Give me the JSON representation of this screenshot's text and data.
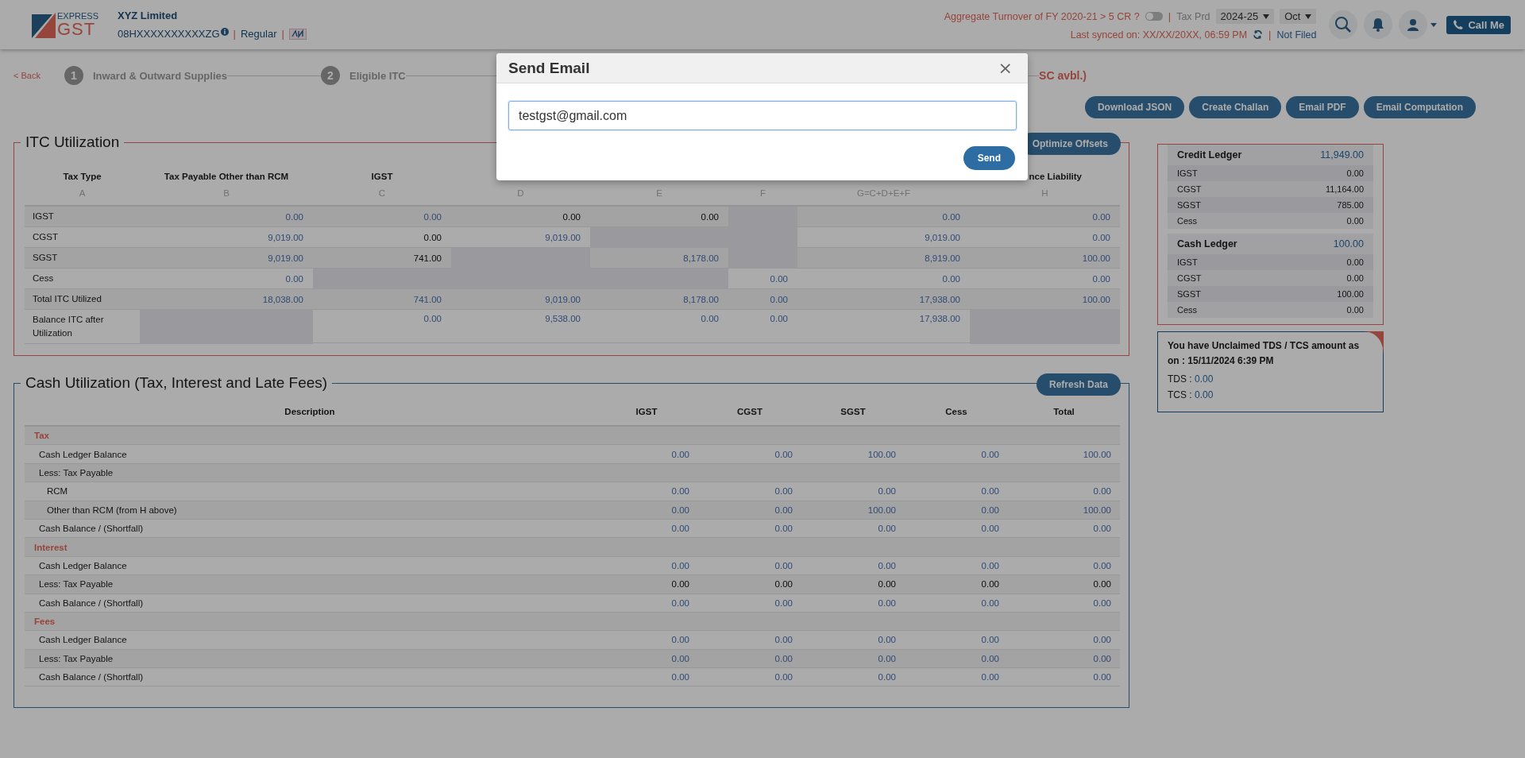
{
  "header": {
    "logo": {
      "top": "EXPRESS",
      "bottom": "GST"
    },
    "company": "XYZ Limited",
    "gstin": "08HXXXXXXXXXXZG",
    "separator_1": "|",
    "registration": "Regular",
    "separator_2": "|",
    "turnover_question": "Aggregate Turnover of FY 2020-21 > 5 CR ?",
    "turnover_toggle": {
      "on": false
    },
    "separator_3": "|",
    "tax_period_label": "Tax Prd",
    "year_select": "2024-25",
    "month_select": "Oct",
    "last_synced": "Last synced on: XX/XX/20XX, 06:59 PM",
    "separator_4": "|",
    "filing_status": "Not Filed",
    "call_button": "Call Me"
  },
  "steps": {
    "back": "< Back",
    "items": [
      {
        "number": "1",
        "label": "Inward & Outward Supplies"
      },
      {
        "number": "2",
        "label": "Eligible ITC"
      }
    ],
    "partial_note": "SC avbl.)"
  },
  "actions": [
    "Download JSON",
    "Create Challan",
    "Email PDF",
    "Email Computation"
  ],
  "itc": {
    "title": "ITC Utilization",
    "action": "Optimize Offsets",
    "columns": [
      {
        "heading": "Tax Type",
        "letter": "A"
      },
      {
        "heading": "Tax Payable Other than RCM",
        "letter": "B"
      },
      {
        "heading": "IGST",
        "letter": "C"
      },
      {
        "letter": "D"
      },
      {
        "letter": "E"
      },
      {
        "letter": "F"
      },
      {
        "letter": "G=C+D+E+F"
      },
      {
        "heading": "nce Liability",
        "letter": "H"
      }
    ],
    "rows": [
      {
        "label": "IGST",
        "cells": [
          {
            "kind": "link",
            "value": "0.00"
          },
          {
            "kind": "link",
            "value": "0.00"
          },
          {
            "kind": "plain",
            "value": "0.00"
          },
          {
            "kind": "plain",
            "value": "0.00"
          },
          {
            "kind": "blank"
          },
          {
            "kind": "link",
            "value": "0.00"
          },
          {
            "kind": "link",
            "value": "0.00"
          }
        ]
      },
      {
        "label": "CGST",
        "cells": [
          {
            "kind": "link",
            "value": "9,019.00"
          },
          {
            "kind": "plain",
            "value": "0.00"
          },
          {
            "kind": "link",
            "value": "9,019.00"
          },
          {
            "kind": "blank"
          },
          {
            "kind": "blank"
          },
          {
            "kind": "link",
            "value": "9,019.00"
          },
          {
            "kind": "link",
            "value": "0.00"
          }
        ]
      },
      {
        "label": "SGST",
        "cells": [
          {
            "kind": "link",
            "value": "9,019.00"
          },
          {
            "kind": "plain",
            "value": "741.00"
          },
          {
            "kind": "blank"
          },
          {
            "kind": "link",
            "value": "8,178.00"
          },
          {
            "kind": "blank"
          },
          {
            "kind": "link",
            "value": "8,919.00"
          },
          {
            "kind": "link",
            "value": "100.00"
          }
        ]
      },
      {
        "label": "Cess",
        "cells": [
          {
            "kind": "link",
            "value": "0.00"
          },
          {
            "kind": "blank"
          },
          {
            "kind": "blank"
          },
          {
            "kind": "blank"
          },
          {
            "kind": "link",
            "value": "0.00"
          },
          {
            "kind": "link",
            "value": "0.00"
          },
          {
            "kind": "link",
            "value": "0.00"
          }
        ]
      },
      {
        "label": "Total ITC Utilized",
        "cells": [
          {
            "kind": "link",
            "value": "18,038.00"
          },
          {
            "kind": "link",
            "value": "741.00"
          },
          {
            "kind": "link",
            "value": "9,019.00"
          },
          {
            "kind": "link",
            "value": "8,178.00"
          },
          {
            "kind": "link",
            "value": "0.00"
          },
          {
            "kind": "link",
            "value": "17,938.00"
          },
          {
            "kind": "link",
            "value": "100.00"
          }
        ]
      },
      {
        "label": "Balance ITC after Utilization",
        "cells": [
          {
            "kind": "blank"
          },
          {
            "kind": "link",
            "value": "0.00"
          },
          {
            "kind": "link",
            "value": "9,538.00"
          },
          {
            "kind": "link",
            "value": "0.00"
          },
          {
            "kind": "link",
            "value": "0.00"
          },
          {
            "kind": "link",
            "value": "17,938.00"
          },
          {
            "kind": "blank"
          }
        ]
      }
    ]
  },
  "ledgers": [
    {
      "title": "Credit Ledger",
      "total": "11,949.00",
      "rows": [
        {
          "label": "IGST",
          "value": "0.00"
        },
        {
          "label": "CGST",
          "value": "11,164.00"
        },
        {
          "label": "SGST",
          "value": "785.00"
        },
        {
          "label": "Cess",
          "value": "0.00"
        }
      ]
    },
    {
      "title": "Cash Ledger",
      "total": "100.00",
      "rows": [
        {
          "label": "IGST",
          "value": "0.00"
        },
        {
          "label": "CGST",
          "value": "0.00"
        },
        {
          "label": "SGST",
          "value": "100.00"
        },
        {
          "label": "Cess",
          "value": "0.00"
        }
      ]
    }
  ],
  "tds": {
    "message": "You have Unclaimed TDS / TCS amount as on : 15/11/2024 6:39 PM",
    "items": [
      {
        "label": "TDS :",
        "value": "0.00"
      },
      {
        "label": "TCS :",
        "value": "0.00"
      }
    ]
  },
  "cash": {
    "title": "Cash Utilization (Tax, Interest and Late Fees)",
    "action": "Refresh Data",
    "columns": [
      "Description",
      "IGST",
      "CGST",
      "SGST",
      "Cess",
      "Total"
    ],
    "sections": [
      {
        "title": "Tax",
        "rows": [
          {
            "label": "Cash Ledger Balance",
            "kind": "link",
            "values": [
              "0.00",
              "0.00",
              "100.00",
              "0.00",
              "100.00"
            ]
          },
          {
            "label": "Less: Tax Payable",
            "children": [
              {
                "label": "RCM",
                "kind": "link",
                "values": [
                  "0.00",
                  "0.00",
                  "0.00",
                  "0.00",
                  "0.00"
                ]
              },
              {
                "label": "Other than RCM (from H above)",
                "kind": "link",
                "values": [
                  "0.00",
                  "0.00",
                  "100.00",
                  "0.00",
                  "100.00"
                ]
              }
            ]
          },
          {
            "label": "Cash Balance / (Shortfall)",
            "kind": "link",
            "values": [
              "0.00",
              "0.00",
              "0.00",
              "0.00",
              "0.00"
            ]
          }
        ]
      },
      {
        "title": "Interest",
        "rows": [
          {
            "label": "Cash Ledger Balance",
            "kind": "link",
            "values": [
              "0.00",
              "0.00",
              "0.00",
              "0.00",
              "0.00"
            ]
          },
          {
            "label": "Less: Tax Payable",
            "kind": "plain",
            "values": [
              "0.00",
              "0.00",
              "0.00",
              "0.00",
              "0.00"
            ]
          },
          {
            "label": "Cash Balance / (Shortfall)",
            "kind": "link",
            "values": [
              "0.00",
              "0.00",
              "0.00",
              "0.00",
              "0.00"
            ]
          }
        ]
      },
      {
        "title": "Fees",
        "rows": [
          {
            "label": "Cash Ledger Balance",
            "kind": "link",
            "values": [
              "0.00",
              "0.00",
              "0.00",
              "0.00",
              "0.00"
            ]
          },
          {
            "label": "Less: Tax Payable",
            "kind": "link",
            "values": [
              "0.00",
              "0.00",
              "0.00",
              "0.00",
              "0.00"
            ]
          },
          {
            "label": "Cash Balance / (Shortfall)",
            "kind": "link",
            "values": [
              "0.00",
              "0.00",
              "0.00",
              "0.00",
              "0.00"
            ]
          }
        ]
      }
    ]
  },
  "modal": {
    "title": "Send Email",
    "close": "×",
    "email": "testgst@gmail.com",
    "send": "Send"
  }
}
